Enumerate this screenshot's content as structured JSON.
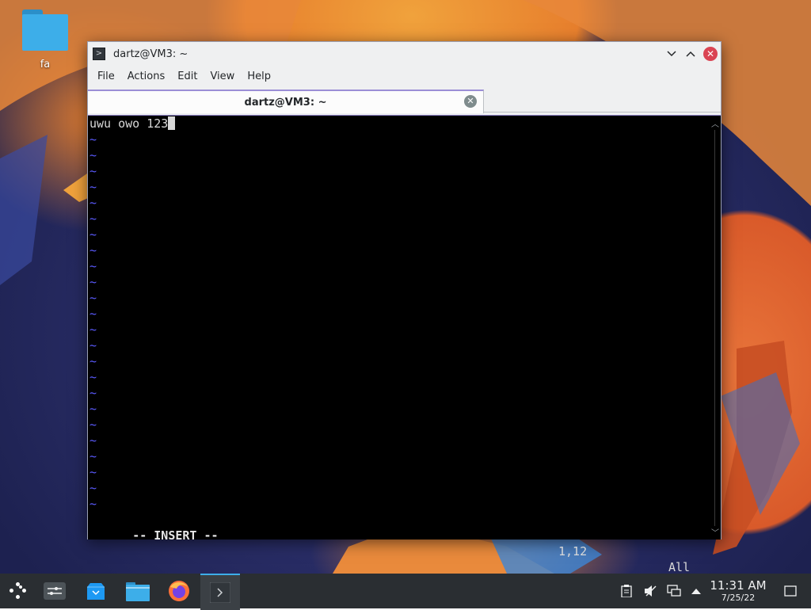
{
  "desktop": {
    "icons": [
      {
        "label": "fa",
        "icon": "folder-icon"
      }
    ]
  },
  "window": {
    "title": "dartz@VM3: ~",
    "controls": [
      "minimize-icon",
      "maximize-icon",
      "close-icon"
    ],
    "menu": [
      "File",
      "Actions",
      "Edit",
      "View",
      "Help"
    ],
    "tab": {
      "label": "dartz@VM3: ~"
    }
  },
  "terminal": {
    "first_line": "uwu owo 123",
    "tilde": "~",
    "status": {
      "mode": "-- INSERT --",
      "position": "1,12",
      "scroll": "All"
    }
  },
  "taskbar": {
    "apps": [
      "application-launcher",
      "system-settings",
      "discover",
      "dolphin-file-manager",
      "firefox",
      "konsole"
    ],
    "tray": [
      "clipboard-icon",
      "volume-muted-icon",
      "network-icon",
      "tray-expand-icon"
    ],
    "clock": {
      "time": "11:31 AM",
      "date": "7/25/22"
    }
  },
  "colors": {
    "accent": "#3daee9",
    "close": "#da4453",
    "vim_tilde": "#5b5bff"
  }
}
